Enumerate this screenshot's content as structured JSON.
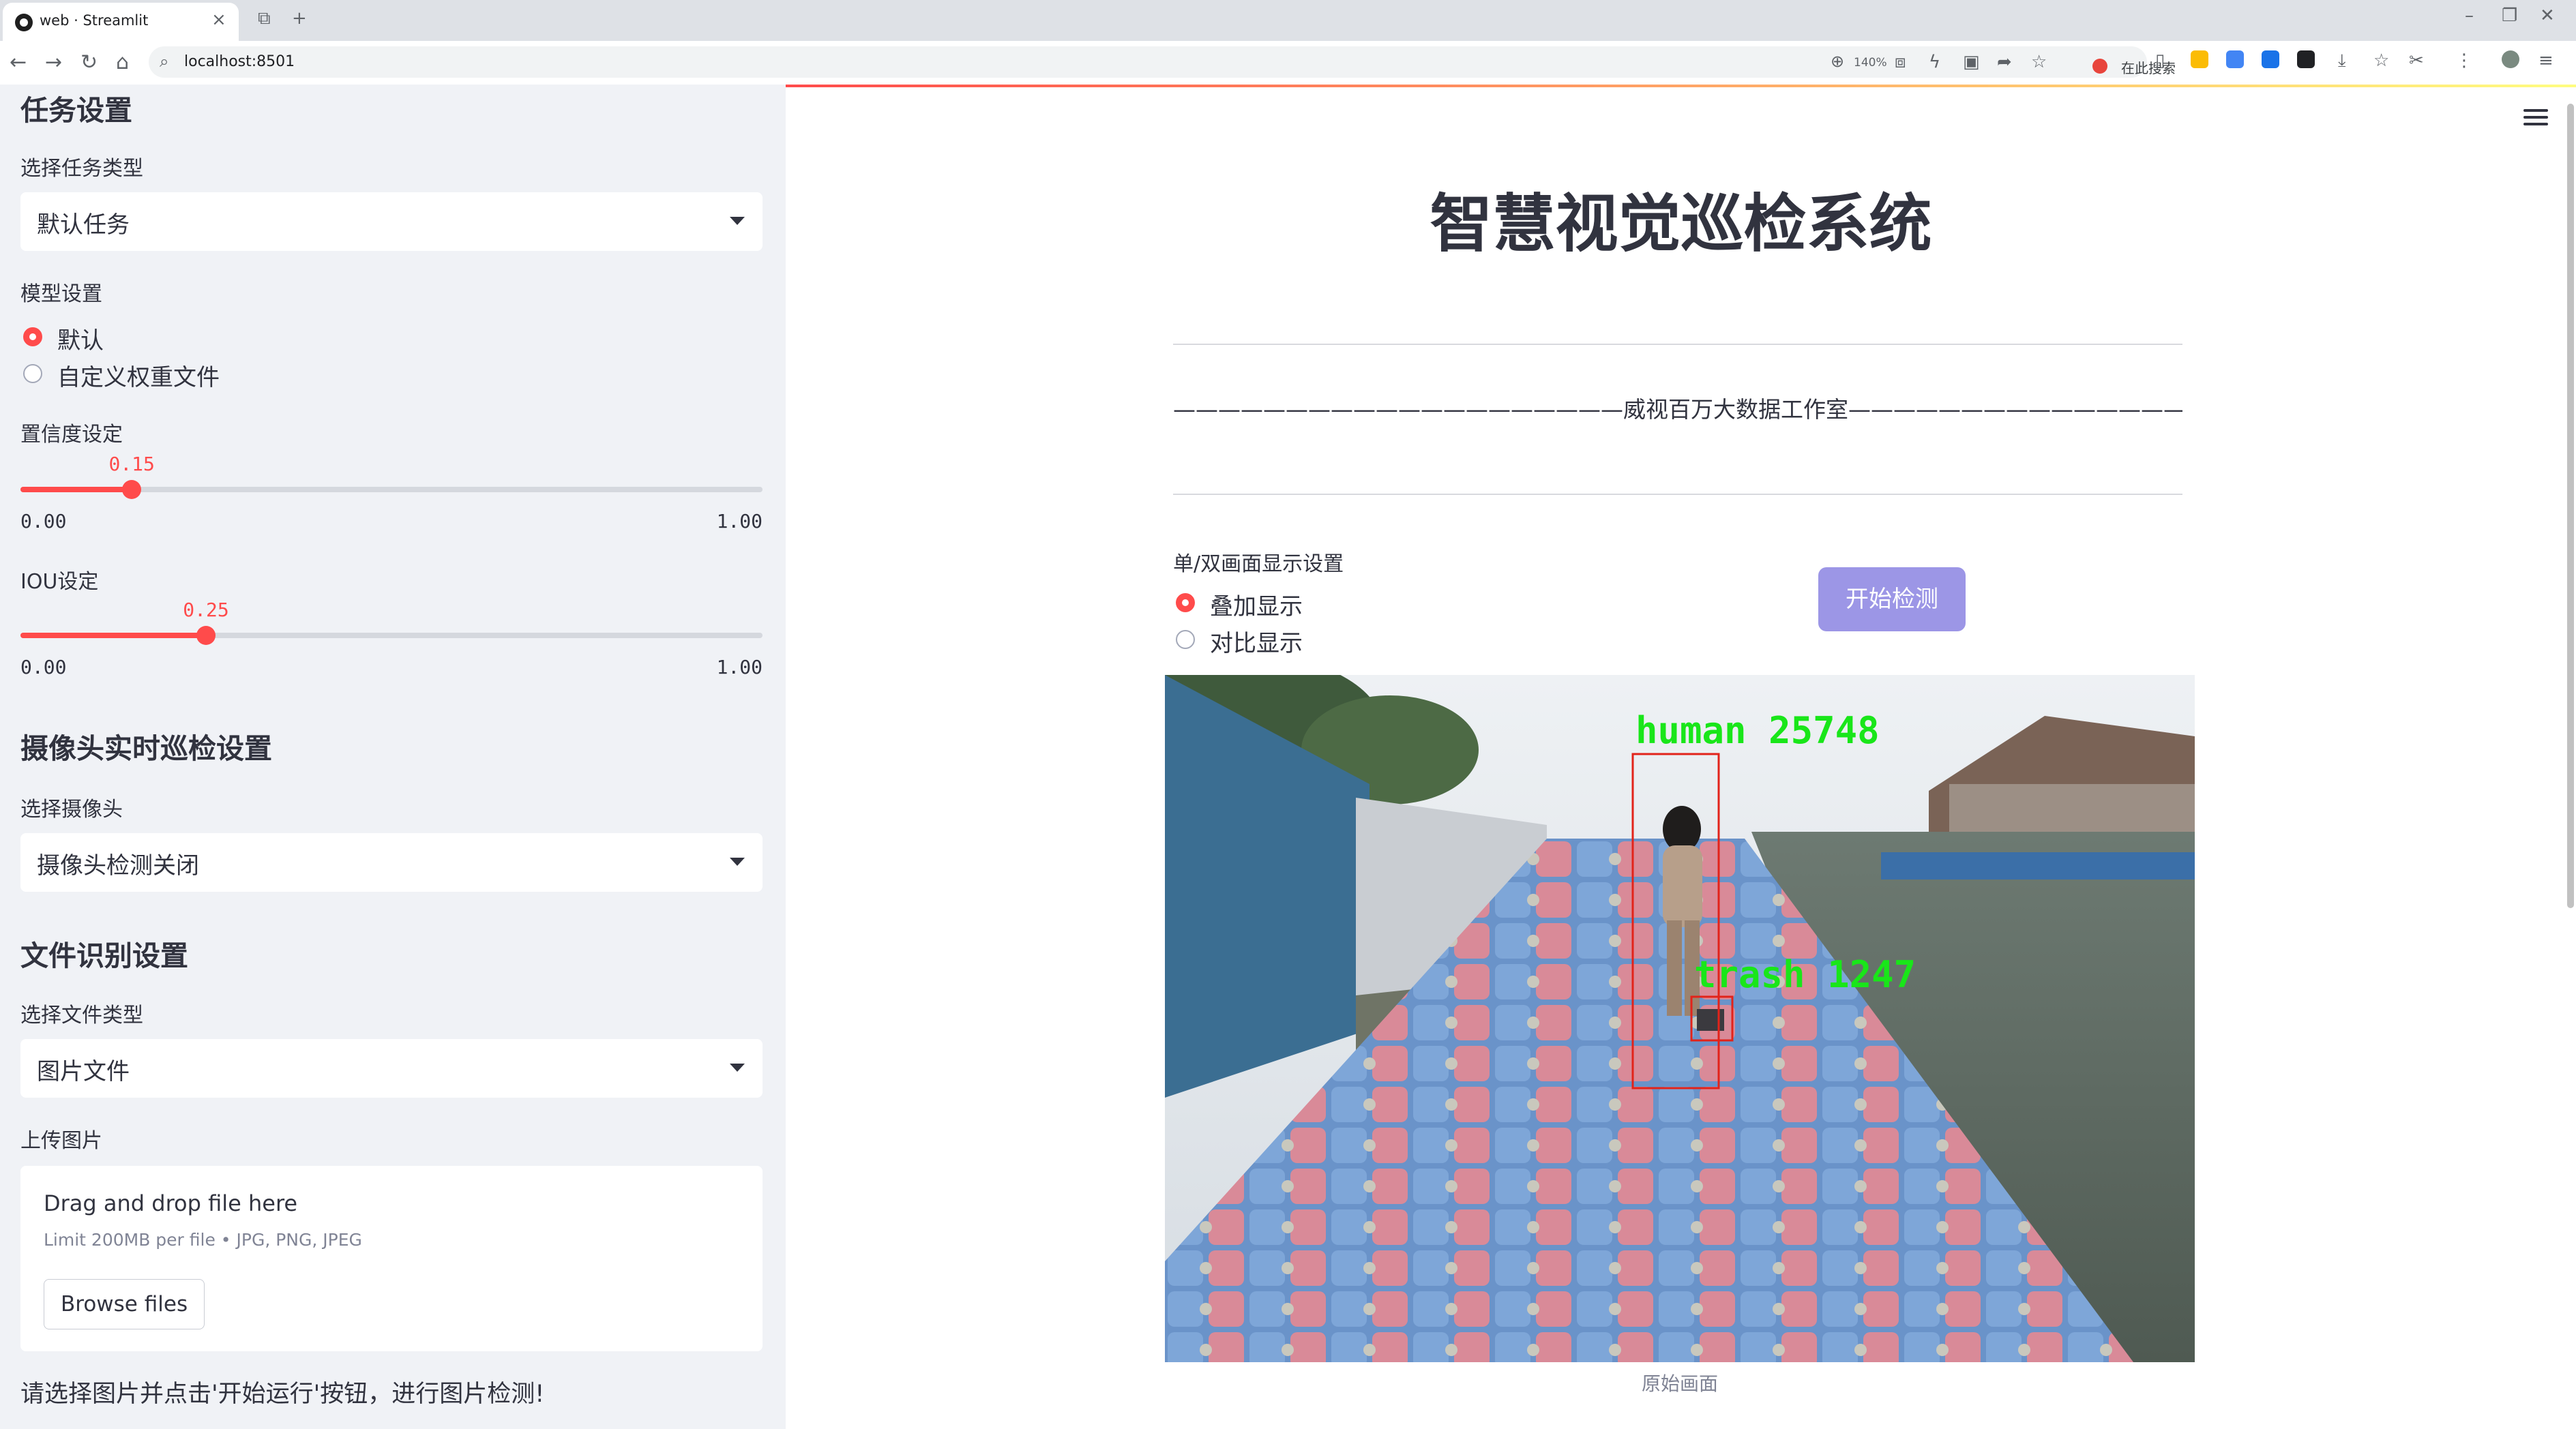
{
  "browser": {
    "tab_title": "web · Streamlit",
    "url": "localhost:8501",
    "zoom": "140%",
    "search_engine_label": "在此搜索"
  },
  "sidebar": {
    "task_section": {
      "heading": "任务设置",
      "task_type_label": "选择任务类型",
      "task_type_value": "默认任务"
    },
    "model_section": {
      "label": "模型设置",
      "options": [
        "默认",
        "自定义权重文件"
      ],
      "selected": 0
    },
    "confidence": {
      "label": "置信度设定",
      "value": 0.15,
      "value_text": "0.15",
      "min": 0,
      "max": 1,
      "min_text": "0.00",
      "max_text": "1.00"
    },
    "iou": {
      "label": "IOU设定",
      "value": 0.25,
      "value_text": "0.25",
      "min": 0,
      "max": 1,
      "min_text": "0.00",
      "max_text": "1.00"
    },
    "camera_section": {
      "heading": "摄像头实时巡检设置",
      "label": "选择摄像头",
      "value": "摄像头检测关闭"
    },
    "file_section": {
      "heading": "文件识别设置",
      "file_type_label": "选择文件类型",
      "file_type_value": "图片文件",
      "upload_label": "上传图片",
      "drop_text": "Drag and drop file here",
      "limit_text": "Limit 200MB per file • JPG, PNG, JPEG",
      "browse_label": "Browse files"
    },
    "hint": "请选择图片并点击'开始运行'按钮，进行图片检测!"
  },
  "main": {
    "title": "智慧视觉巡检系统",
    "divider_text": "————————————————————威视百万大数据工作室—————————————————————",
    "display_label": "单/双画面显示设置",
    "display_options": [
      "叠加显示",
      "对比显示"
    ],
    "display_selected": 0,
    "start_button": "开始检测",
    "detections": [
      {
        "label": "human 25748"
      },
      {
        "label": "trash 1247"
      }
    ],
    "image_caption": "原始画面"
  },
  "colors": {
    "accent": "#ff4b4b",
    "button": "#9c96e6",
    "sidebar_bg": "#f0f2f6",
    "box_red": "#e2231a",
    "label_green": "#19e619"
  }
}
